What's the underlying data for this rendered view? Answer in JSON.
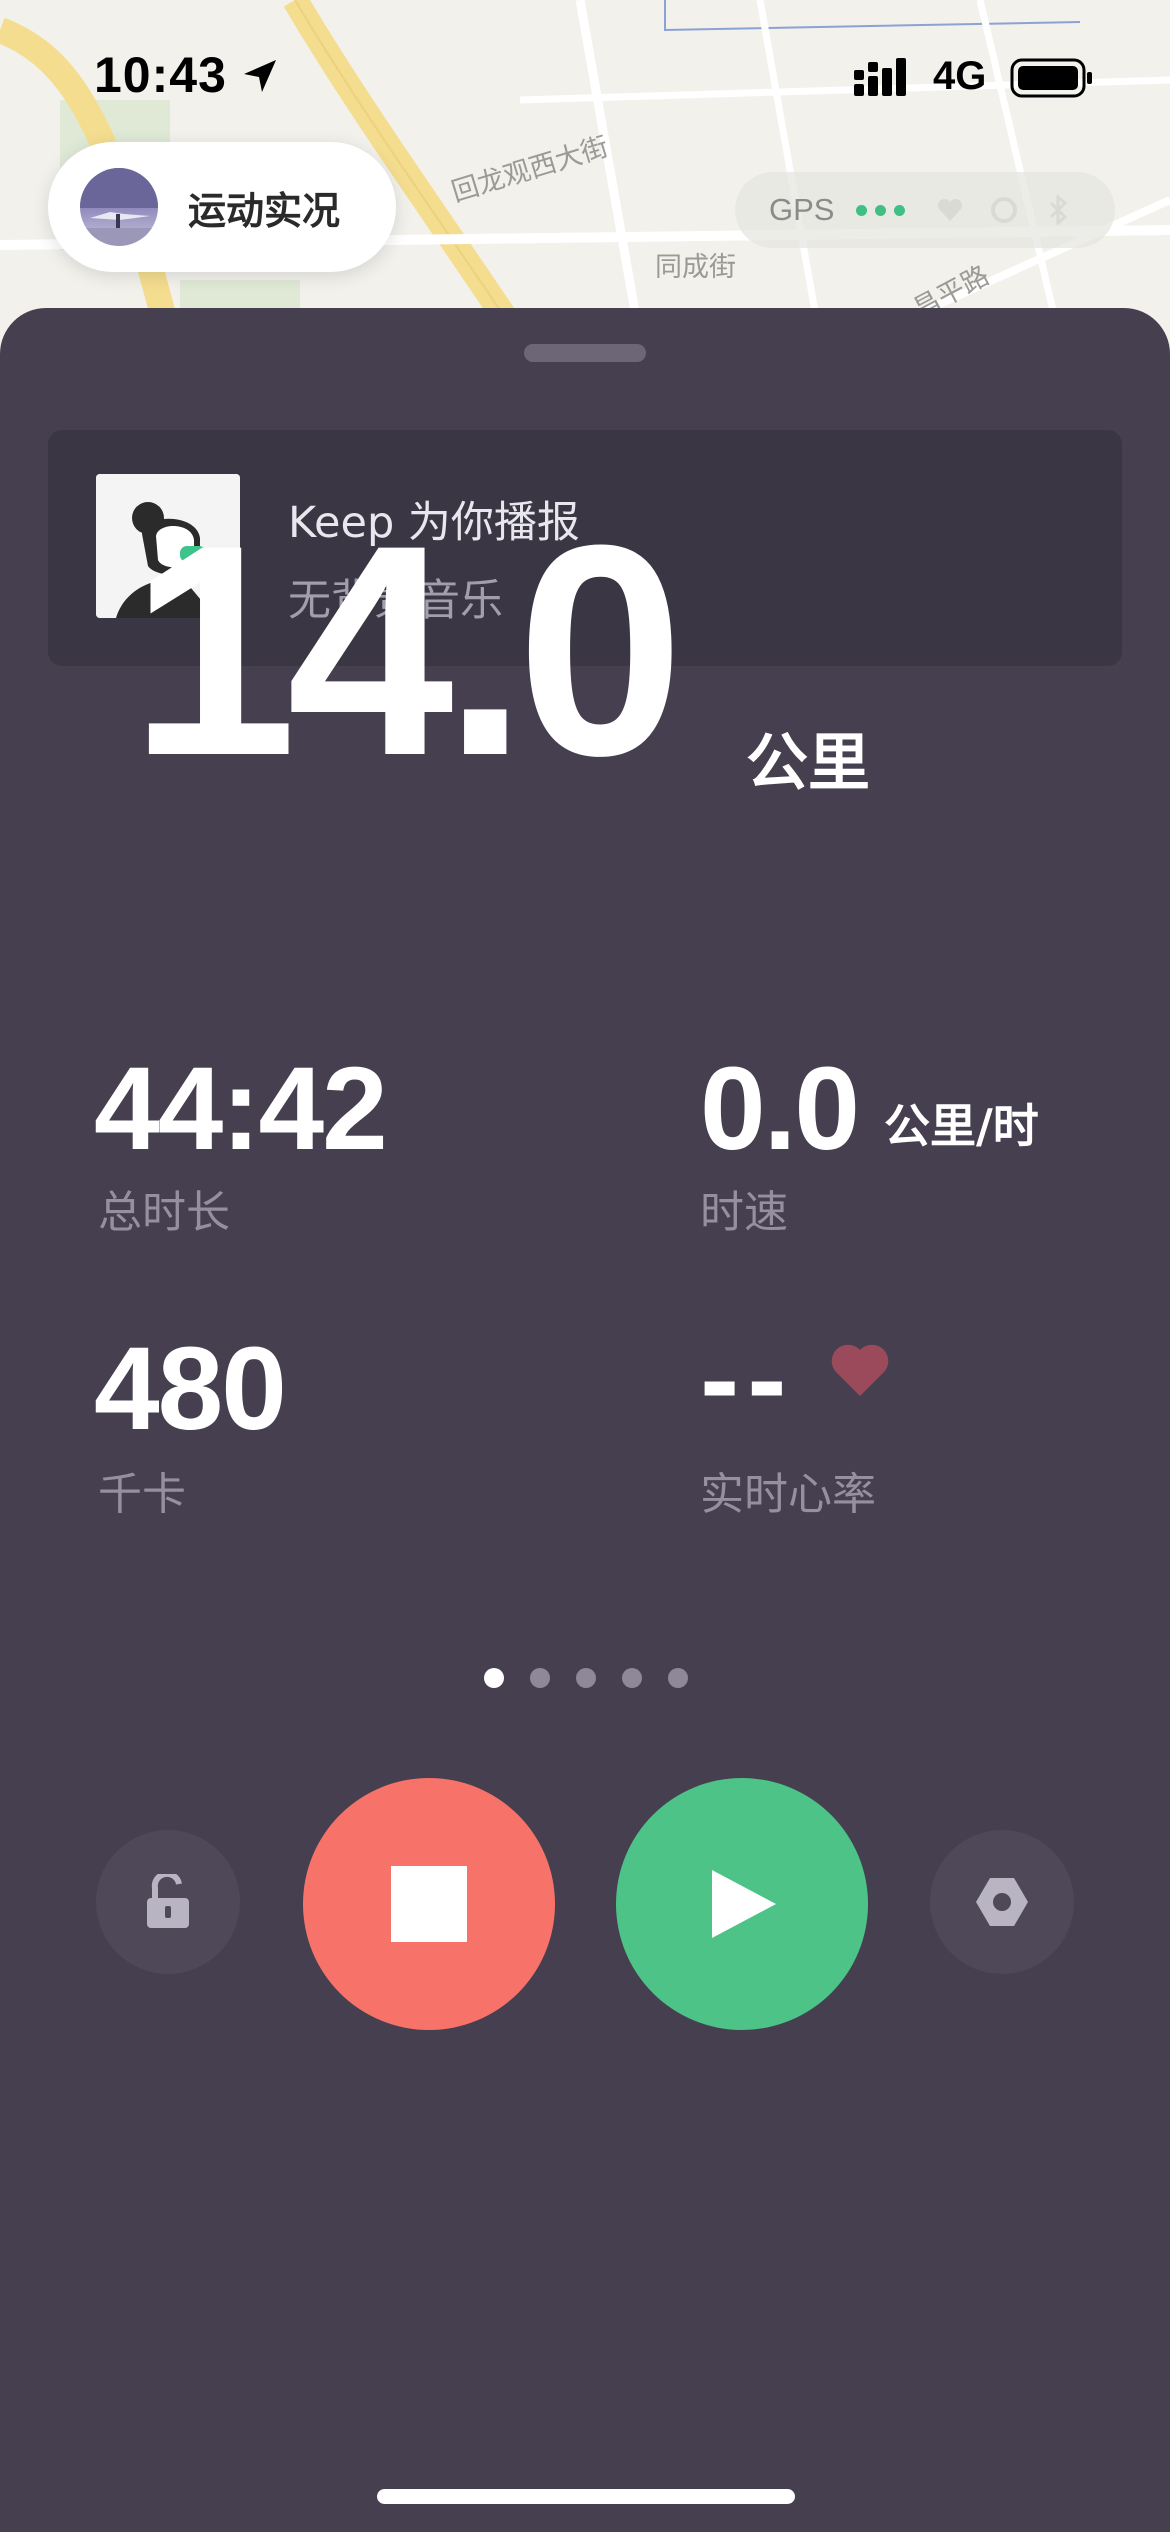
{
  "status_bar": {
    "time": "10:43",
    "network": "4G"
  },
  "map": {
    "street_1": "回龙观西大街",
    "street_2": "同成街",
    "street_3": "昌平路"
  },
  "live_chip": {
    "label": "运动实况"
  },
  "gps": {
    "label": "GPS",
    "signal_color": "#3fbf84"
  },
  "music": {
    "title": "Keep 为你播报",
    "subtitle": "无背景音乐"
  },
  "distance": {
    "value": "14.0",
    "unit": "公里"
  },
  "stats": {
    "duration": {
      "value": "44:42",
      "label": "总时长"
    },
    "speed": {
      "value": "0.0",
      "unit": "公里/时",
      "label": "时速"
    },
    "calories": {
      "value": "480",
      "label": "千卡"
    },
    "heart_rate": {
      "value": "--",
      "label": "实时心率",
      "icon": "heart-icon",
      "icon_color": "#9a4a5b"
    }
  },
  "pager": {
    "total": 5,
    "active": 1
  },
  "controls": {
    "lock": "lock-icon",
    "stop": {
      "icon": "stop-icon",
      "color": "#f7736a"
    },
    "play": {
      "icon": "play-icon",
      "color": "#4dc388"
    },
    "settings": "settings-icon"
  },
  "colors": {
    "panel_bg": "#453f4f",
    "card_bg": "#3b3644",
    "label_text": "#958f9f"
  }
}
